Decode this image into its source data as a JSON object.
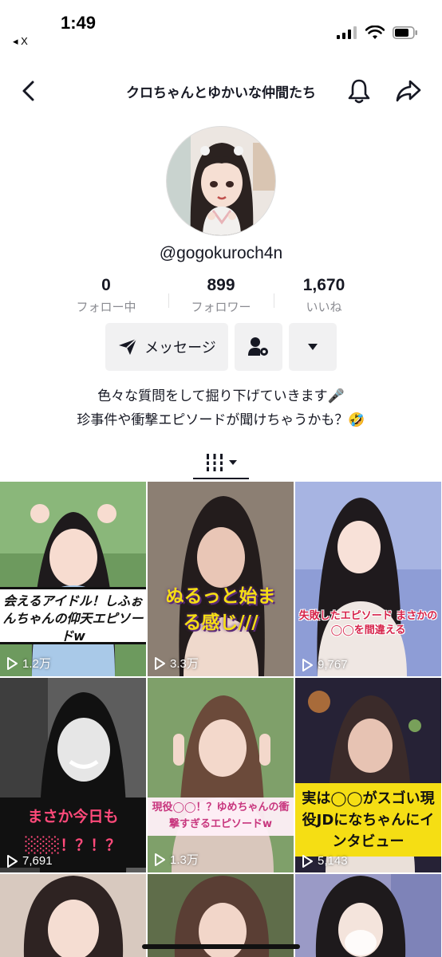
{
  "status_bar": {
    "time": "1:49",
    "back_app": "◂ X"
  },
  "header": {
    "title": "クロちゃんとゆかいな仲間たち"
  },
  "profile": {
    "username": "@gogokuroch4n",
    "stats": [
      {
        "value": "0",
        "label": "フォロー中"
      },
      {
        "value": "899",
        "label": "フォロワー"
      },
      {
        "value": "1,670",
        "label": "いいね"
      }
    ],
    "message_label": "メッセージ",
    "bio_line1": "色々な質問をして掘り下げていきます🎤",
    "bio_line2": "珍事件や衝撃エピソードが聞けちゃうかも？🤣"
  },
  "videos": [
    {
      "caption": "会えるアイドル！しふぉんちゃんの仰天エピソードw",
      "views": "1.2万"
    },
    {
      "caption": "ぬるっと始まる感じ///",
      "views": "3.3万"
    },
    {
      "caption": "失敗したエピソード まさかの◯◯を間違える",
      "views": "9,767"
    },
    {
      "caption": "まさか今日も ░░░！？！？",
      "views": "7,691"
    },
    {
      "caption": "現役◯◯！？ゆめちゃんの衝撃すぎるエピソードw",
      "views": "1.3万"
    },
    {
      "caption": "実は◯◯がスゴい現役JDになちゃんにインタビュー",
      "views": "5,143"
    },
    {
      "caption": "",
      "views": ""
    },
    {
      "caption": "",
      "views": ""
    },
    {
      "caption": "",
      "views": ""
    }
  ],
  "colors": {
    "text": "#161823",
    "secondary": "#8a8b91",
    "button_bg": "#f1f1f2",
    "caption_yellow": "#f5de14",
    "caption_pink": "#d63a8c"
  }
}
